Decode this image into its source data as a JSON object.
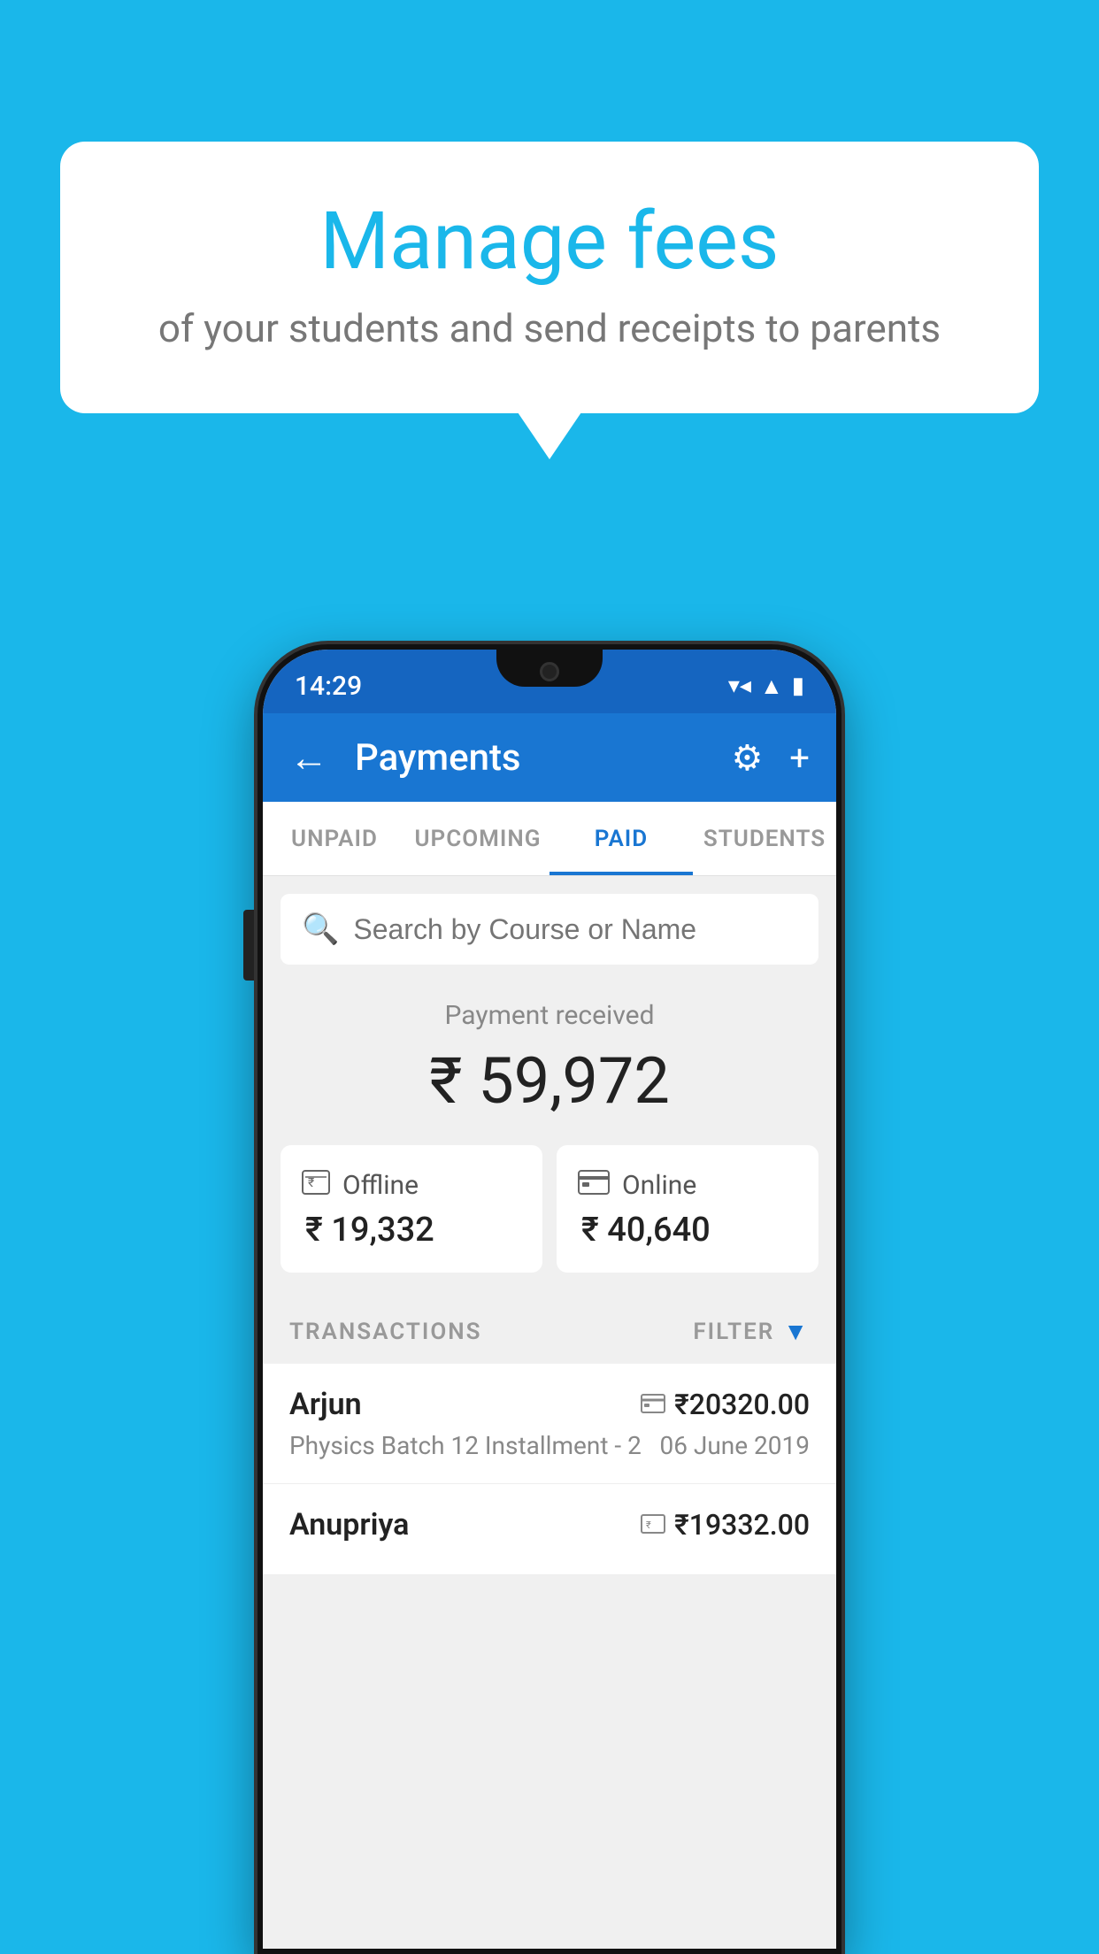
{
  "page": {
    "background_color": "#1ab7ea"
  },
  "bubble": {
    "title": "Manage fees",
    "subtitle": "of your students and send receipts to parents"
  },
  "status_bar": {
    "time": "14:29",
    "icons": [
      "wifi",
      "signal",
      "battery"
    ]
  },
  "app_bar": {
    "title": "Payments",
    "back_label": "←",
    "gear_label": "⚙",
    "plus_label": "+"
  },
  "tabs": [
    {
      "label": "UNPAID",
      "active": false
    },
    {
      "label": "UPCOMING",
      "active": false
    },
    {
      "label": "PAID",
      "active": true
    },
    {
      "label": "STUDENTS",
      "active": false
    }
  ],
  "search": {
    "placeholder": "Search by Course or Name"
  },
  "payment": {
    "label": "Payment received",
    "amount": "₹ 59,972",
    "offline_label": "Offline",
    "offline_amount": "₹ 19,332",
    "online_label": "Online",
    "online_amount": "₹ 40,640"
  },
  "transactions_header": {
    "label": "TRANSACTIONS",
    "filter_label": "FILTER"
  },
  "transactions": [
    {
      "name": "Arjun",
      "detail": "Physics Batch 12 Installment - 2",
      "amount": "₹20320.00",
      "date": "06 June 2019",
      "payment_type": "card"
    },
    {
      "name": "Anupriya",
      "detail": "",
      "amount": "₹19332.00",
      "date": "",
      "payment_type": "cash"
    }
  ]
}
